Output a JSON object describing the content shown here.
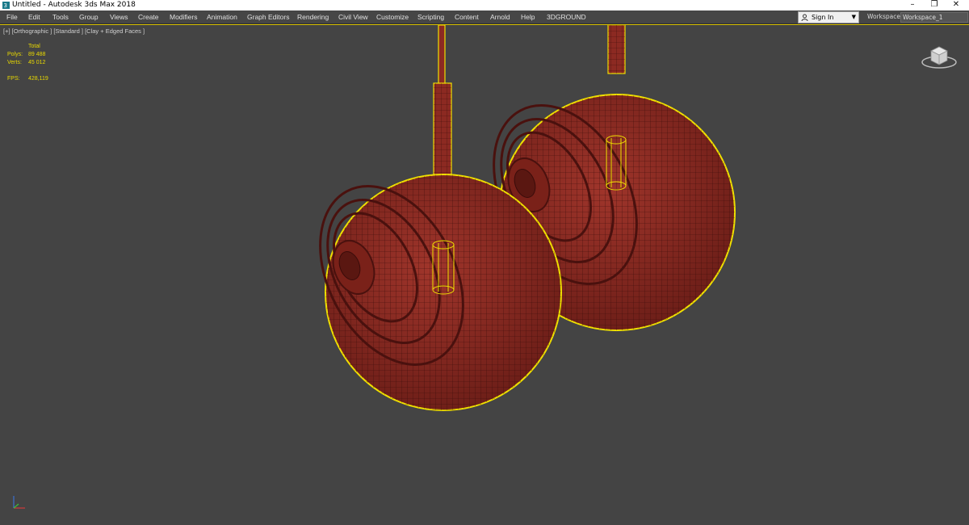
{
  "window": {
    "title": "Untitled - Autodesk 3ds Max 2018",
    "controls": [
      "–",
      "❐",
      "✕"
    ]
  },
  "menu": {
    "items": [
      "File",
      "Edit",
      "Tools",
      "Group",
      "Views",
      "Create",
      "Modifiers",
      "Animation",
      "Graph Editors",
      "Rendering",
      "Civil View",
      "Customize",
      "Scripting",
      "Content",
      "Arnold",
      "Help",
      "3DGROUND"
    ]
  },
  "account": {
    "signin_label": "Sign In",
    "dropdown_icon": "▼"
  },
  "workspaces": {
    "label": "Workspaces:",
    "value": "Workspace_1"
  },
  "viewport": {
    "label": "[+] [Orthographic ] [Standard ] [Clay + Edged Faces ]",
    "stats": {
      "header": "Total",
      "polys_label": "Polys:",
      "polys_value": "89 488",
      "verts_label": "Verts:",
      "verts_value": "45 012",
      "fps_label": "FPS:",
      "fps_value": "428,119"
    }
  },
  "colors": {
    "viewport_bg": "#444444",
    "mesh": "#8c2a22",
    "selection": "#f0e000",
    "stats_text": "#e8d800"
  },
  "icons": {
    "app": "3dsmax-logo-icon",
    "user": "user-icon",
    "viewcube": "viewcube-icon",
    "axis": "axis-tripod-icon"
  }
}
